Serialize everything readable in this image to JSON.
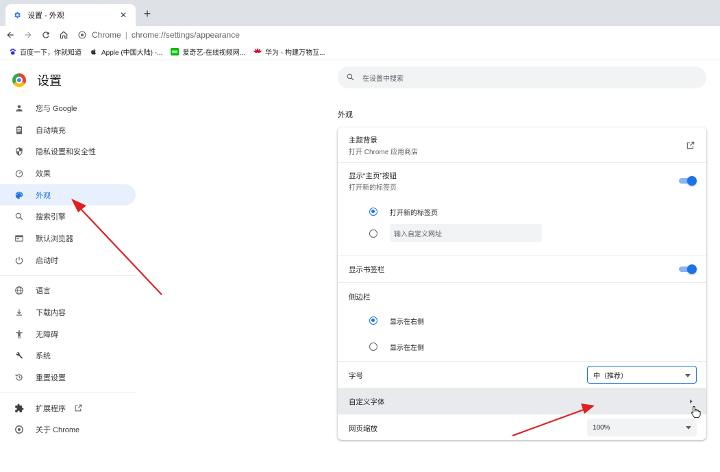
{
  "browser": {
    "tab": {
      "title": "设置 - 外观",
      "icon": "gear-icon",
      "close": "✕"
    },
    "new_tab": "+",
    "toolbar": {
      "site_name": "Chrome",
      "separator": "|",
      "url": "chrome://settings/appearance"
    },
    "bookmarks": [
      {
        "label": "百度一下，你就知道",
        "icon": "baidu-paw-icon",
        "color": "#2932e1"
      },
      {
        "label": "Apple (中国大陆) -...",
        "icon": "apple-icon",
        "color": "#333333"
      },
      {
        "label": "爱奇艺-在线视频网...",
        "icon": "iqiyi-icon",
        "color": "#00be06"
      },
      {
        "label": "华为 - 构建万物互...",
        "icon": "huawei-icon",
        "color": "#cf0a2c"
      }
    ]
  },
  "settings": {
    "title": "设置",
    "search_placeholder": "在设置中搜索",
    "menu": [
      {
        "label": "您与 Google",
        "icon": "person-icon"
      },
      {
        "label": "自动填充",
        "icon": "clipboard-icon"
      },
      {
        "label": "隐私设置和安全性",
        "icon": "shield-icon"
      },
      {
        "label": "效果",
        "icon": "speedometer-icon"
      },
      {
        "label": "外观",
        "icon": "palette-icon",
        "active": true
      },
      {
        "label": "搜索引擎",
        "icon": "search-icon"
      },
      {
        "label": "默认浏览器",
        "icon": "browser-window-icon"
      },
      {
        "label": "启动时",
        "icon": "power-icon"
      },
      {
        "label": "语言",
        "icon": "globe-icon"
      },
      {
        "label": "下载内容",
        "icon": "download-icon"
      },
      {
        "label": "无障碍",
        "icon": "accessibility-icon"
      },
      {
        "label": "系统",
        "icon": "wrench-icon"
      },
      {
        "label": "重置设置",
        "icon": "reset-icon"
      },
      {
        "label": "扩展程序",
        "icon": "puzzle-icon"
      },
      {
        "label": "关于 Chrome",
        "icon": "chrome-icon"
      }
    ],
    "section_title": "外观",
    "theme": {
      "label": "主题背景",
      "sub": "打开 Chrome 应用商店"
    },
    "home_button": {
      "label": "显示“主页”按钮",
      "sub": "打开新的标签页",
      "enabled": true,
      "option_new_tab": "打开新的标签页",
      "custom_url_placeholder": "输入自定义网址"
    },
    "bookmarks_bar": {
      "label": "显示书签栏",
      "enabled": true
    },
    "side_panel": {
      "label": "侧边栏",
      "option_right": "显示在右侧",
      "option_left": "显示在左侧"
    },
    "font_size": {
      "label": "字号",
      "value": "中（推荐）"
    },
    "custom_fonts": {
      "label": "自定义字体"
    },
    "page_zoom": {
      "label": "网页缩放",
      "value": "100%"
    },
    "accent_color": "#1a73e8",
    "annotation_color": "#e02020"
  }
}
